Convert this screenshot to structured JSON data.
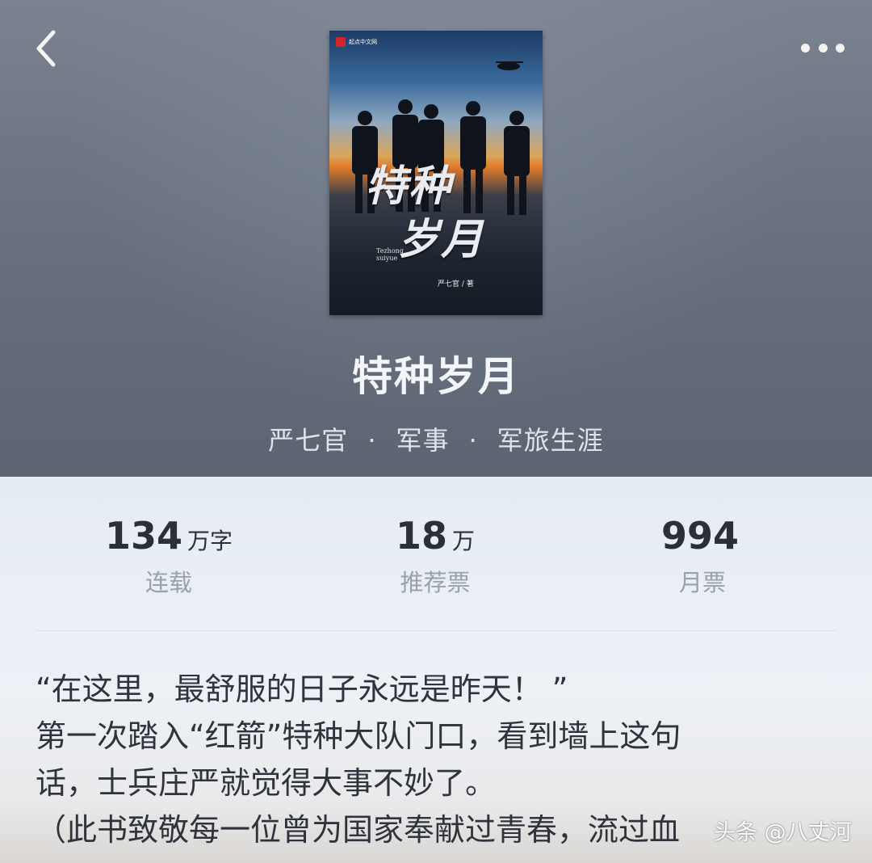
{
  "cover": {
    "logo_text": "起点中文网",
    "title_line1": "特种",
    "title_line2": "岁月",
    "pinyin": "Tezhong suiyue",
    "author": "严七官 / 著"
  },
  "book": {
    "title": "特种岁月",
    "author": "严七官",
    "category": "军事",
    "subcategory": "军旅生涯",
    "separator": "·"
  },
  "stats": [
    {
      "number": "134",
      "unit": "万字",
      "label": "连载"
    },
    {
      "number": "18",
      "unit": "万",
      "label": "推荐票"
    },
    {
      "number": "994",
      "unit": "",
      "label": "月票"
    }
  ],
  "description": {
    "lines": [
      "“在这里，最舒服的日子永远是昨天！ ”",
      "第一次踏入“红箭”特种大队门口，看到墙上这句",
      "话，士兵庄严就觉得大事不妙了。",
      "（此书致敬每一位曾为国家奉献过青春，流过血"
    ]
  },
  "watermark": "头条 @八丈河",
  "icons": {
    "back": "chevron-left-icon",
    "more": "more-dots-icon"
  }
}
